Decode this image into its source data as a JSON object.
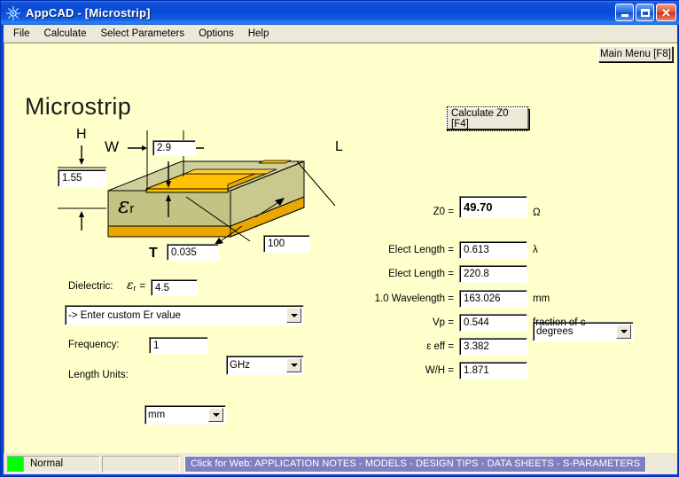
{
  "window": {
    "app_name": "AppCAD",
    "doc_name": "[Microstrip]",
    "title_separator": " - ",
    "icon": "sun-burst-icon",
    "minimize_label": "Minimize",
    "maximize_label": "Maximize",
    "close_label": "Close",
    "titlebar_color": "#0a4ad6",
    "client_bg": "#ffffcc"
  },
  "menu": {
    "items": [
      {
        "label": "File"
      },
      {
        "label": "Calculate"
      },
      {
        "label": "Select Parameters"
      },
      {
        "label": "Options"
      },
      {
        "label": "Help"
      }
    ]
  },
  "header": {
    "page_title": "Microstrip",
    "main_menu_button": "Main Menu [F8]"
  },
  "diagram": {
    "substrate_color": "#c3c383",
    "substrate_top_color": "#cfcf9a",
    "conductor_color": "#ffc000",
    "conductor_light": "#ffd24d",
    "labels": {
      "w": "W",
      "h": "H",
      "t": "T",
      "l": "L",
      "er": "ε",
      "er_sub": "r"
    },
    "values": {
      "w": "2.9",
      "h": "1.55",
      "t": "0.035",
      "l": "100"
    }
  },
  "inputs": {
    "dielectric_label": "Dielectric:",
    "dielectric_sym": "ε",
    "dielectric_sub": "r",
    "dielectric_eq": "=",
    "er_value": "4.5",
    "material_select": "-> Enter custom Er value",
    "frequency_label": "Frequency:",
    "frequency_value": "1",
    "frequency_unit": "GHz",
    "length_units_label": "Length Units:",
    "length_units_value": "mm"
  },
  "results": {
    "calculate_button": "Calculate Z0  [F4]",
    "rows": [
      {
        "label": "Z0 =",
        "value": "49.70",
        "unit": "Ω",
        "bold": true
      },
      {
        "label": "Elect Length =",
        "value": "0.613",
        "unit": "λ",
        "bold": false
      },
      {
        "label": "Elect Length =",
        "value": "220.8",
        "unit": "degrees",
        "bold": false,
        "is_combo": true
      },
      {
        "label": "1.0 Wavelength =",
        "value": "163.026",
        "unit": "mm",
        "bold": false
      },
      {
        "label": "Vp =",
        "value": "0.544",
        "unit": "fraction of c",
        "bold": false
      },
      {
        "label": "ε eff =",
        "value": "3.382",
        "unit": "",
        "bold": false
      },
      {
        "label": "W/H =",
        "value": "1.871",
        "unit": "",
        "bold": false
      }
    ]
  },
  "status": {
    "mode": "Normal",
    "led_color": "#00ff00",
    "web_link": "Click for Web: APPLICATION NOTES - MODELS - DESIGN TIPS - DATA SHEETS - S-PARAMETERS"
  }
}
